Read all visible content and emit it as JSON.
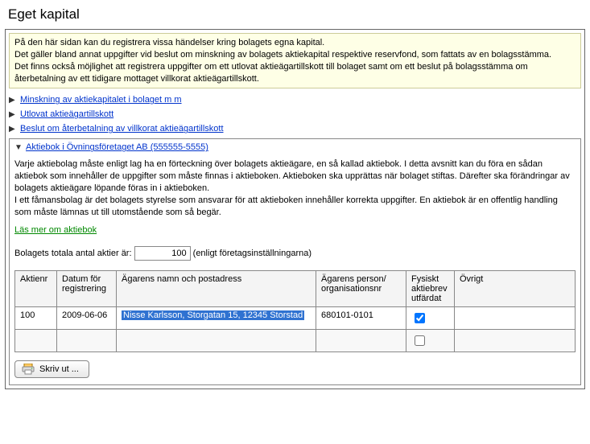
{
  "page_title": "Eget kapital",
  "info_box": {
    "line1": "På den här sidan kan du registrera vissa händelser kring bolagets egna kapital.",
    "line2": "Det gäller bland annat uppgifter vid beslut om minskning av bolagets aktiekapital respektive reservfond, som fattats av en bolagsstämma.",
    "line3": "Det finns också möjlighet att registrera uppgifter om ett utlovat aktieägartillskott till bolaget samt om ett beslut på bolagsstämma om återbetalning av ett tidigare mottaget villkorat aktieägartillskott."
  },
  "expanders": {
    "minskning": "Minskning av aktiekapitalet i bolaget m m",
    "utlovat": "Utlovat aktieägartillskott",
    "beslut": "Beslut om återbetalning av villkorat aktieägartillskott",
    "aktiebok": "Aktiebok i Övningsföretaget AB (555555-5555)"
  },
  "aktiebok": {
    "desc1": "Varje aktiebolag måste enligt lag ha en förteckning över bolagets aktieägare, en så kallad aktiebok. I detta avsnitt kan du föra en sådan aktiebok som innehåller de uppgifter som måste finnas i aktieboken. Aktieboken ska upprättas när bolaget stiftas. Därefter ska förändringar av bolagets aktieägare löpande föras in i aktieboken.",
    "desc2": "I ett fåmansbolag är det bolagets styrelse som ansvarar för att aktieboken innehåller korrekta uppgifter. En aktiebok är en offentlig handling som måste lämnas ut till utomstående som så begär.",
    "read_more": "Läs mer om aktiebok",
    "totals_label": "Bolagets totala antal aktier är:",
    "totals_value": "100",
    "totals_suffix": "(enligt företagsinställningarna)",
    "headers": {
      "aktienr": "Aktienr",
      "datum": "Datum för registrering",
      "namn": "Ägarens namn och postadress",
      "orgnr": "Ägarens person/ organisationsnr",
      "fysiskt": "Fysiskt aktiebrev utfärdat",
      "ovrigt": "Övrigt"
    },
    "rows": [
      {
        "aktienr": "100",
        "datum": "2009-06-06",
        "namn": "Nisse Karlsson, Storgatan 15,  12345 Storstad",
        "orgnr": "680101-0101",
        "fysiskt": true,
        "ovrigt": ""
      }
    ],
    "print_label": "Skriv ut ..."
  }
}
